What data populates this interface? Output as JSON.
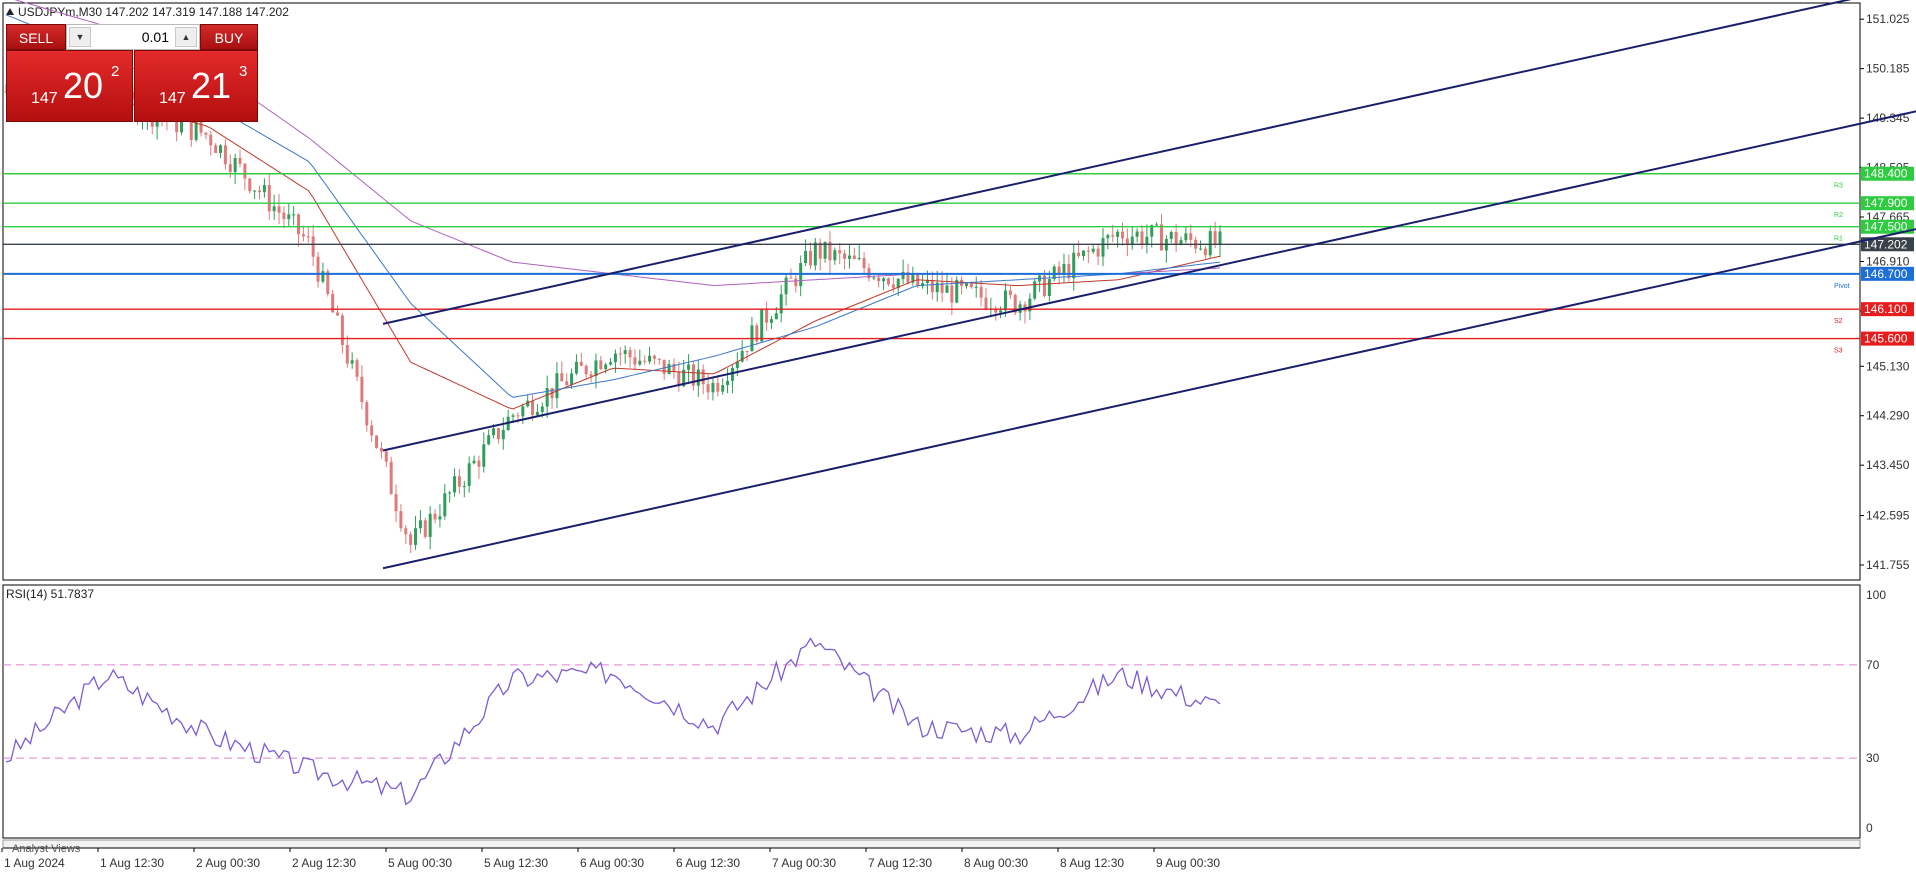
{
  "header": {
    "symbol_info": "USDJPYm,M30  147.202 147.319 147.188 147.202"
  },
  "trade_panel": {
    "sell_label": "SELL",
    "buy_label": "BUY",
    "lot": "0.01",
    "sell_price_prefix": "147",
    "sell_price_big": "20",
    "sell_price_sup": "2",
    "buy_price_prefix": "147",
    "buy_price_big": "21",
    "buy_price_sup": "3"
  },
  "price_axis_ticks": [
    "151.025",
    "150.185",
    "149.345",
    "148.505",
    "147.665",
    "146.910",
    "146.070",
    "145.130",
    "144.290",
    "143.450",
    "142.595",
    "141.755"
  ],
  "levels": [
    {
      "label": "R3",
      "value": "148.400",
      "color": "#2ecc40"
    },
    {
      "label": "R2",
      "value": "147.900",
      "color": "#2ecc40"
    },
    {
      "label": "R1",
      "value": "147.500",
      "color": "#2ecc40"
    },
    {
      "label": "",
      "value": "147.202",
      "color": "#39414a"
    },
    {
      "label": "Pivot",
      "value": "146.700",
      "color": "#1c6fd8"
    },
    {
      "label": "S2",
      "value": "146.100",
      "color": "#e81c1c"
    },
    {
      "label": "S3",
      "value": "145.600",
      "color": "#e81c1c"
    }
  ],
  "rsi": {
    "title": "RSI(14) 51.7837",
    "ticks": [
      "100",
      "70",
      "30",
      "0"
    ]
  },
  "time_axis": [
    "1 Aug 2024",
    "1 Aug 12:30",
    "2 Aug 00:30",
    "2 Aug 12:30",
    "5 Aug 00:30",
    "5 Aug 12:30",
    "6 Aug 00:30",
    "6 Aug 12:30",
    "7 Aug 00:30",
    "7 Aug 12:30",
    "8 Aug 00:30",
    "8 Aug 12:30",
    "9 Aug 00:30"
  ],
  "bottom_tab": "Analyst Views",
  "colors": {
    "bull": "#2e9e5b",
    "bear": "#e07a7a",
    "ma_fast": "#c0392b",
    "ma_mid": "#3a78c9",
    "ma_slow": "#b060c0",
    "channel": "#1a1f6b",
    "rsi_line": "#7b5cd6",
    "rsi_level": "#e87fd0"
  },
  "chart_data": [
    {
      "type": "candlestick",
      "title": "USDJPYm,M30",
      "x": [
        "1 Aug 2024",
        "1 Aug 12:30",
        "2 Aug 00:30",
        "2 Aug 12:30",
        "5 Aug 00:30",
        "5 Aug 12:30",
        "6 Aug 00:30",
        "6 Aug 12:30",
        "7 Aug 00:30",
        "7 Aug 12:30",
        "8 Aug 00:30",
        "8 Aug 12:30",
        "9 Aug 00:30"
      ],
      "close": [
        149.8,
        149.72,
        149.05,
        147.2,
        142.1,
        144.3,
        145.4,
        144.8,
        147.1,
        146.5,
        146.2,
        147.4,
        147.2
      ],
      "ylim": [
        141.5,
        151.3
      ],
      "series": [
        {
          "name": "MA fast",
          "values": [
            149.6,
            149.7,
            149.2,
            148.1,
            145.2,
            144.4,
            145.1,
            145.0,
            145.9,
            146.6,
            146.5,
            146.6,
            147.0
          ]
        },
        {
          "name": "MA mid",
          "values": [
            151.1,
            150.4,
            149.6,
            148.6,
            146.2,
            144.6,
            144.9,
            145.3,
            145.8,
            146.5,
            146.6,
            146.7,
            146.9
          ]
        },
        {
          "name": "MA slow",
          "values": [
            151.4,
            150.9,
            150.2,
            149.0,
            147.6,
            146.9,
            146.7,
            146.5,
            146.6,
            146.7,
            146.7,
            146.7,
            146.8
          ]
        }
      ],
      "horizontal_levels": [
        148.4,
        147.9,
        147.5,
        147.202,
        146.7,
        146.1,
        145.6
      ],
      "channel_lines": [
        {
          "x": [
            "5 Aug 00:30",
            "9 Aug 12:30"
          ],
          "y": [
            145.85,
            151.7
          ]
        },
        {
          "x": [
            "5 Aug 00:30",
            "9 Aug 12:30"
          ],
          "y": [
            143.7,
            149.55
          ]
        },
        {
          "x": [
            "5 Aug 00:30",
            "9 Aug 12:30"
          ],
          "y": [
            141.7,
            147.55
          ]
        }
      ],
      "grid": false
    },
    {
      "type": "line",
      "title": "RSI(14) 51.7837",
      "x": [
        "1 Aug 2024",
        "1 Aug 12:30",
        "2 Aug 00:30",
        "2 Aug 12:30",
        "5 Aug 00:30",
        "5 Aug 12:30",
        "6 Aug 00:30",
        "6 Aug 12:30",
        "7 Aug 00:30",
        "7 Aug 12:30",
        "8 Aug 00:30",
        "8 Aug 12:30",
        "9 Aug 00:30"
      ],
      "series": [
        {
          "values": [
            30,
            66,
            40,
            25,
            14,
            64,
            67,
            44,
            80,
            44,
            40,
            66,
            52
          ]
        }
      ],
      "ylim": [
        0,
        100
      ],
      "reference_lines": [
        70,
        30
      ],
      "grid": false
    }
  ]
}
